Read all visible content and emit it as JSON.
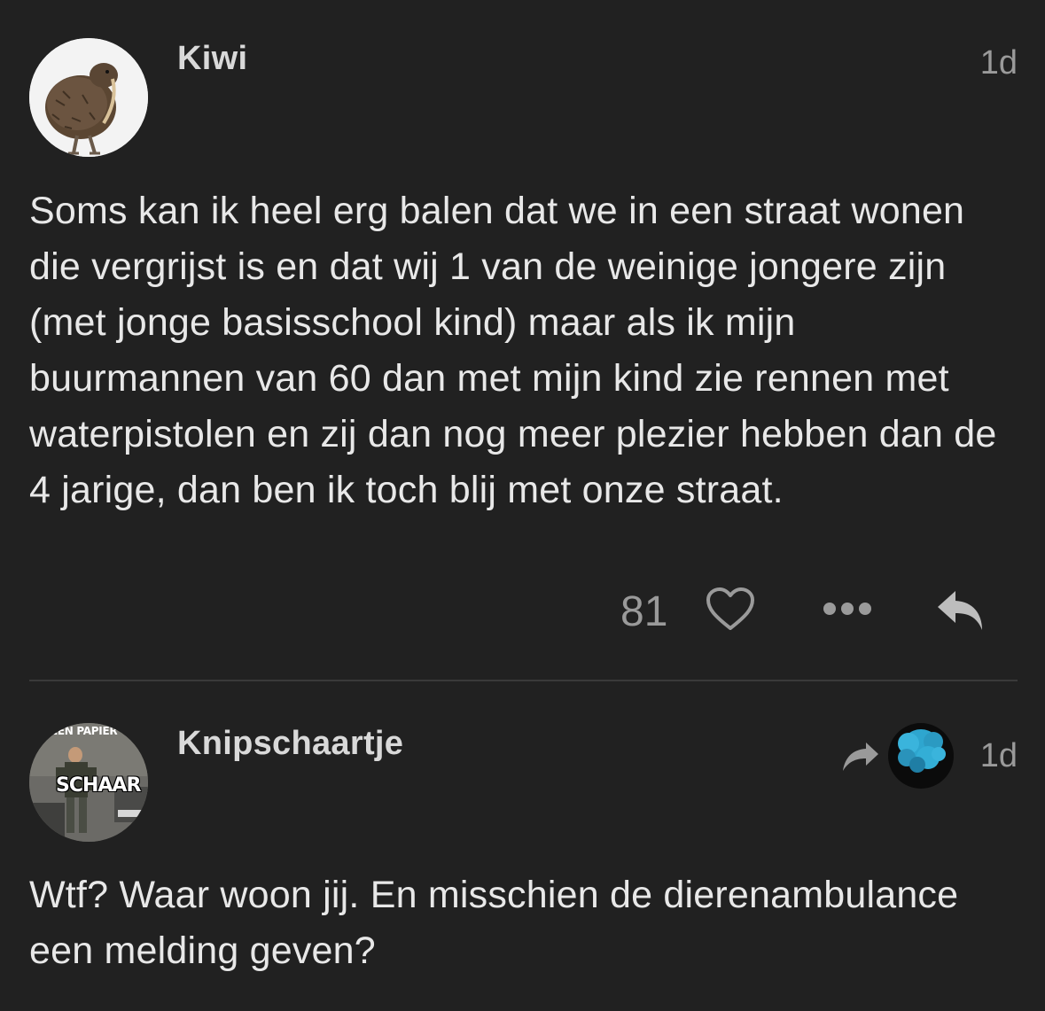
{
  "posts": [
    {
      "username": "Kiwi",
      "timestamp": "1d",
      "body": "Soms kan ik heel erg balen dat we in een straat wonen die vergrijst is en dat wij 1 van de weinige jongere zijn (met jonge basisschool kind) maar als ik mijn buurmannen van 60 dan met mijn kind zie rennen met waterpistolen en zij dan nog meer plezier hebben dan de 4 jarige, dan ben ik toch blij met onze straat.",
      "likes": "81",
      "avatar": "kiwi-bird-avatar"
    },
    {
      "username": "Knipschaartje",
      "timestamp": "1d",
      "body": "Wtf? Waar woon jij. En misschien de dierenambulance een melding geven?",
      "avatar": "meme-avatar",
      "avatar_text_top": "EEN PAPIER",
      "avatar_text_main": "SCHAAR",
      "reply_to_avatar": "blue-smoke-avatar"
    }
  ],
  "icons": {
    "like": "heart-outline-icon",
    "more": "ellipsis-icon",
    "reply": "reply-arrow-icon",
    "reply_to": "share-arrow-icon"
  },
  "colors": {
    "background": "#212121",
    "text": "#e8e8e8",
    "muted": "#9a9a9a",
    "divider": "#3a3a3a"
  }
}
